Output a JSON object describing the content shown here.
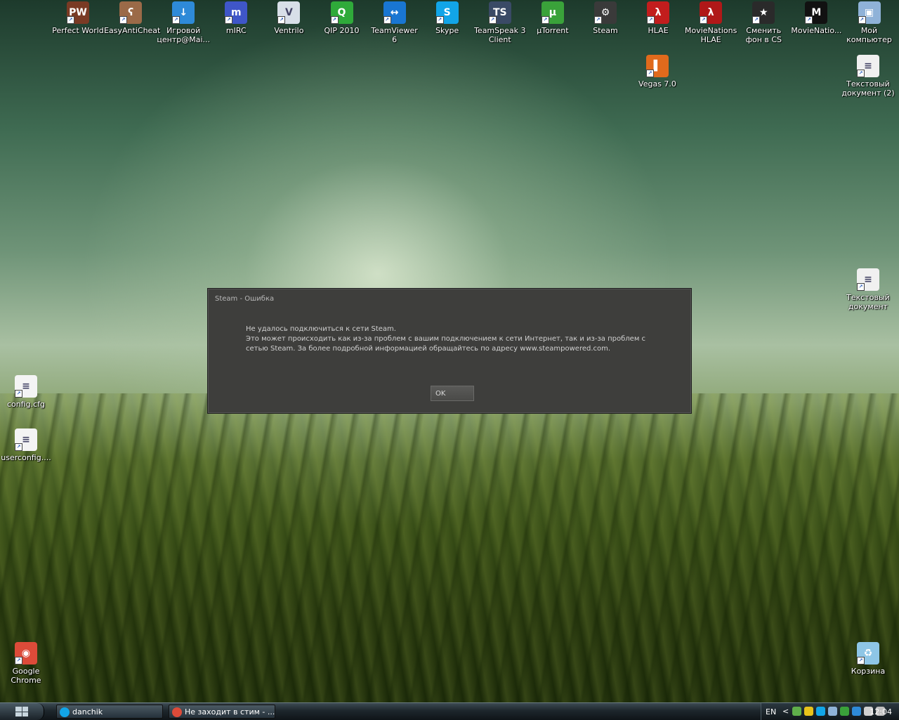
{
  "desktop": {
    "icons": [
      {
        "label": "Perfect World",
        "icon": "perfect-world-icon",
        "color": "#7a3a24",
        "glyph": "PW"
      },
      {
        "label": "EasyAntiCheat",
        "icon": "teddy-bear-icon",
        "color": "#9b6a48",
        "glyph": "ʕ"
      },
      {
        "label": "Игровой центр@Mai...",
        "icon": "download-arrow-icon",
        "color": "#2e8ad8",
        "glyph": "↓"
      },
      {
        "label": "mIRC",
        "icon": "mirc-icon",
        "color": "#3f56c8",
        "glyph": "m"
      },
      {
        "label": "Ventrilo",
        "icon": "ventrilo-headset-icon",
        "color": "#d8dfe8",
        "glyph": "V"
      },
      {
        "label": "QIP 2010",
        "icon": "qip-icon",
        "color": "#2faa3a",
        "glyph": "Q"
      },
      {
        "label": "TeamViewer 6",
        "icon": "teamviewer-icon",
        "color": "#1976d2",
        "glyph": "↔"
      },
      {
        "label": "Skype",
        "icon": "skype-icon",
        "color": "#12a5e8",
        "glyph": "S"
      },
      {
        "label": "TeamSpeak 3 Client",
        "icon": "teamspeak-icon",
        "color": "#3a4a66",
        "glyph": "TS"
      },
      {
        "label": "µTorrent",
        "icon": "utorrent-icon",
        "color": "#3aa23a",
        "glyph": "µ"
      },
      {
        "label": "Steam",
        "icon": "steam-icon",
        "color": "#3a3a3a",
        "glyph": "⚙"
      },
      {
        "label": "HLAE",
        "icon": "hlae-icon",
        "color": "#c21d1d",
        "glyph": "λ"
      },
      {
        "label": "MovieNations HLAE",
        "icon": "movienations-hlae-icon",
        "color": "#b01818",
        "glyph": "λ"
      },
      {
        "label": "Сменить фон в CS",
        "icon": "change-background-icon",
        "color": "#2a2a2a",
        "glyph": "★"
      },
      {
        "label": "MovieNatio...",
        "icon": "movienations-icon",
        "color": "#111111",
        "glyph": "M"
      },
      {
        "label": "Мой компьютер",
        "icon": "my-computer-icon",
        "color": "#8fb2d8",
        "glyph": "▣"
      }
    ],
    "icons_row2": [
      {
        "label": "Vegas 7.0",
        "icon": "vegas-icon",
        "color": "#e06a1c",
        "glyph": "▌"
      },
      {
        "label": "Текстовый документ (2)",
        "icon": "text-document-icon",
        "color": "#f0f0f0",
        "glyph": "≡"
      }
    ],
    "icons_left": [
      {
        "label": "config.cfg",
        "icon": "cfg-file-icon",
        "color": "#f4f4f4",
        "glyph": "≡"
      },
      {
        "label": "userconfig....",
        "icon": "cfg-file-icon",
        "color": "#f4f4f4",
        "glyph": "≡"
      },
      {
        "label": "Google Chrome",
        "icon": "chrome-icon",
        "color": "#dd4b39",
        "glyph": "◉"
      }
    ],
    "icons_right": [
      {
        "label": "Текстовый документ",
        "icon": "text-document-icon",
        "color": "#f0f0f0",
        "glyph": "≡"
      },
      {
        "label": "Корзина",
        "icon": "recycle-bin-icon",
        "color": "#8ec6e6",
        "glyph": "♻"
      }
    ]
  },
  "dialog": {
    "title": "Steam - Ошибка",
    "line1": "Не удалось подключиться к сети Steam.",
    "line2": "Это может происходить как из-за проблем с вашим подключением к сети Интернет, так и из-за проблем с сетью Steam. За более подробной информацией обращайтесь по адресу www.steampowered.com.",
    "ok": "OK"
  },
  "taskbar": {
    "tasks": [
      {
        "label": "danchik",
        "icon": "skype-icon",
        "color": "#12a5e8"
      },
      {
        "label": "Не заходит в стим - ...",
        "icon": "chrome-icon",
        "color": "#dd4b39"
      }
    ],
    "tray": {
      "lang": "EN",
      "chevron": "<",
      "icons": [
        {
          "icon": "network-icon",
          "color": "#5fae4a"
        },
        {
          "icon": "qip-tray-icon",
          "color": "#e8c21a"
        },
        {
          "icon": "skype-tray-icon",
          "color": "#12a5e8"
        },
        {
          "icon": "lan-icon",
          "color": "#8fb2d8"
        },
        {
          "icon": "utorrent-tray-icon",
          "color": "#3aa23a"
        },
        {
          "icon": "download-tray-icon",
          "color": "#2e8ad8"
        },
        {
          "icon": "volume-icon",
          "color": "#d0d0d0"
        },
        {
          "icon": "speaker-icon",
          "color": "#c0c0c0"
        }
      ],
      "clock": "12:04"
    }
  }
}
